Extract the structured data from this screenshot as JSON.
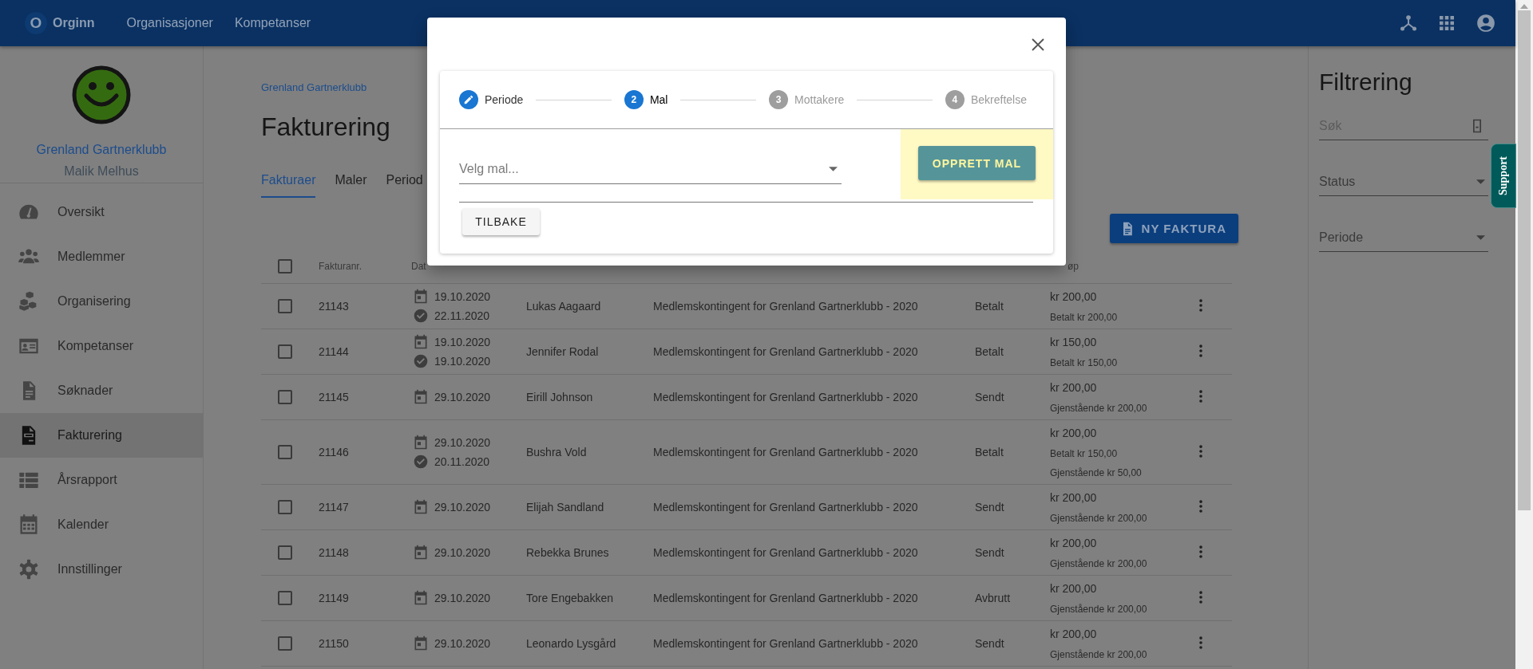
{
  "top_bar": {
    "logo_letter": "O",
    "brand": "Orginn",
    "nav": [
      "Organisasjoner",
      "Kompetanser"
    ]
  },
  "sidebar": {
    "org": "Grenland Gartnerklubb",
    "user": "Malik Melhus",
    "items": [
      {
        "label": "Oversikt",
        "selected": false
      },
      {
        "label": "Medlemmer",
        "selected": false
      },
      {
        "label": "Organisering",
        "selected": false
      },
      {
        "label": "Kompetanser",
        "selected": false
      },
      {
        "label": "Søknader",
        "selected": false
      },
      {
        "label": "Fakturering",
        "selected": true
      },
      {
        "label": "Årsrapport",
        "selected": false
      },
      {
        "label": "Kalender",
        "selected": false
      },
      {
        "label": "Innstillinger",
        "selected": false
      }
    ]
  },
  "main": {
    "breadcrumb": "Grenland Gartnerklubb",
    "title": "Fakturering",
    "tabs": [
      {
        "label": "Fakturaer",
        "selected": true
      },
      {
        "label": "Maler",
        "selected": false
      },
      {
        "label": "Period",
        "selected": false
      }
    ],
    "new_button": "NY FAKTURA",
    "table": {
      "header_checked": false,
      "columns": {
        "number": "Fakturanr.",
        "date": "Dat",
        "amount": "øp"
      },
      "rows": [
        {
          "checked": false,
          "number": "21143",
          "dates": [
            {
              "kind": "created",
              "date": "19.10.2020"
            },
            {
              "kind": "paid",
              "date": "22.11.2020"
            }
          ],
          "name": "Lukas Aagaard",
          "details": "Medlemskontingent for Grenland Gartnerklubb - 2020",
          "status": "Betalt",
          "amount": "kr 200,00",
          "notes": [
            "Betalt kr 200,00"
          ]
        },
        {
          "checked": false,
          "number": "21144",
          "dates": [
            {
              "kind": "created",
              "date": "19.10.2020"
            },
            {
              "kind": "paid",
              "date": "19.10.2020"
            }
          ],
          "name": "Jennifer Rodal",
          "details": "Medlemskontingent for Grenland Gartnerklubb - 2020",
          "status": "Betalt",
          "amount": "kr 150,00",
          "notes": [
            "Betalt kr 150,00"
          ]
        },
        {
          "checked": false,
          "number": "21145",
          "dates": [
            {
              "kind": "created",
              "date": "29.10.2020"
            }
          ],
          "name": "Eirill Johnson",
          "details": "Medlemskontingent for Grenland Gartnerklubb - 2020",
          "status": "Sendt",
          "amount": "kr 200,00",
          "notes": [
            "Gjenstående kr 200,00"
          ]
        },
        {
          "checked": false,
          "number": "21146",
          "dates": [
            {
              "kind": "created",
              "date": "29.10.2020"
            },
            {
              "kind": "paid",
              "date": "20.11.2020"
            }
          ],
          "name": "Bushra Vold",
          "details": "Medlemskontingent for Grenland Gartnerklubb - 2020",
          "status": "Betalt",
          "amount": "kr 200,00",
          "notes": [
            "Betalt kr 150,00",
            "Gjenstående kr 50,00"
          ]
        },
        {
          "checked": false,
          "number": "21147",
          "dates": [
            {
              "kind": "created",
              "date": "29.10.2020"
            }
          ],
          "name": "Elijah Sandland",
          "details": "Medlemskontingent for Grenland Gartnerklubb - 2020",
          "status": "Sendt",
          "amount": "kr 200,00",
          "notes": [
            "Gjenstående kr 200,00"
          ]
        },
        {
          "checked": false,
          "number": "21148",
          "dates": [
            {
              "kind": "created",
              "date": "29.10.2020"
            }
          ],
          "name": "Rebekka Brunes",
          "details": "Medlemskontingent for Grenland Gartnerklubb - 2020",
          "status": "Sendt",
          "amount": "kr 200,00",
          "notes": [
            "Gjenstående kr 200,00"
          ]
        },
        {
          "checked": false,
          "number": "21149",
          "dates": [
            {
              "kind": "created",
              "date": "29.10.2020"
            }
          ],
          "name": "Tore Engebakken",
          "details": "Medlemskontingent for Grenland Gartnerklubb - 2020",
          "status": "Avbrutt",
          "amount": "kr 200,00",
          "notes": [
            "Gjenstående kr 200,00"
          ]
        },
        {
          "checked": false,
          "number": "21150",
          "dates": [
            {
              "kind": "created",
              "date": "29.10.2020"
            }
          ],
          "name": "Leonardo Lysgård",
          "details": "Medlemskontingent for Grenland Gartnerklubb - 2020",
          "status": "Sendt",
          "amount": "kr 200,00",
          "notes": [
            "Gjenstående kr 200,00"
          ]
        }
      ]
    }
  },
  "filter": {
    "title": "Filtrering",
    "fields": [
      {
        "kind": "search",
        "placeholder": "Søk"
      },
      {
        "kind": "select",
        "placeholder": "Status"
      },
      {
        "kind": "select",
        "placeholder": "Periode"
      }
    ],
    "support": "Support"
  },
  "modal": {
    "steps": [
      {
        "completed": true,
        "selected": false,
        "label": "Periode"
      },
      {
        "completed": false,
        "selected": true,
        "number": "2",
        "label": "Mal"
      },
      {
        "completed": false,
        "selected": false,
        "number": "3",
        "label": "Mottakere"
      },
      {
        "completed": false,
        "selected": false,
        "number": "4",
        "label": "Bekreftelse"
      }
    ],
    "select_placeholder": "Velg mal...",
    "create_button": {
      "label": "OPPRETT MAL",
      "highlighted": true
    },
    "back_button": "TILBAKE"
  }
}
